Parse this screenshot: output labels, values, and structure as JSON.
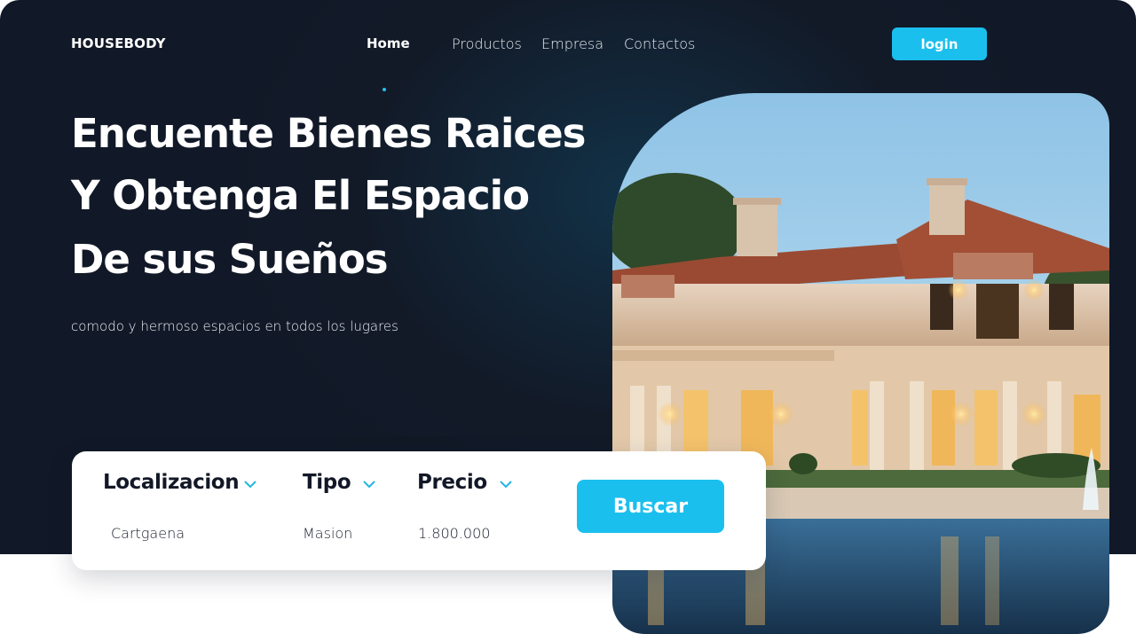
{
  "brand": {
    "name": "HOUSEBODY"
  },
  "nav": {
    "items": [
      {
        "label": "Home",
        "active": true
      },
      {
        "label": "Productos",
        "active": false
      },
      {
        "label": "Empresa",
        "active": false
      },
      {
        "label": "Contactos",
        "active": false
      }
    ],
    "login_label": "login"
  },
  "hero": {
    "lines": [
      "Encuente Bienes Raices",
      "Y Obtenga El Espacio",
      "De sus Sueños"
    ],
    "subtitle": "comodo y hermoso espacios en todos los lugares",
    "image": "luxury-villa-with-pool-at-dusk"
  },
  "search": {
    "filters": [
      {
        "label": "Localizacion",
        "value": "Cartgaena"
      },
      {
        "label": "Tipo",
        "value": "Masion"
      },
      {
        "label": "Precio",
        "value": "1.800.000"
      }
    ],
    "button_label": "Buscar"
  },
  "colors": {
    "background": "#111827",
    "accent": "#1bbfee",
    "card": "#ffffff"
  },
  "icons": [
    "chevron-down-icon"
  ]
}
